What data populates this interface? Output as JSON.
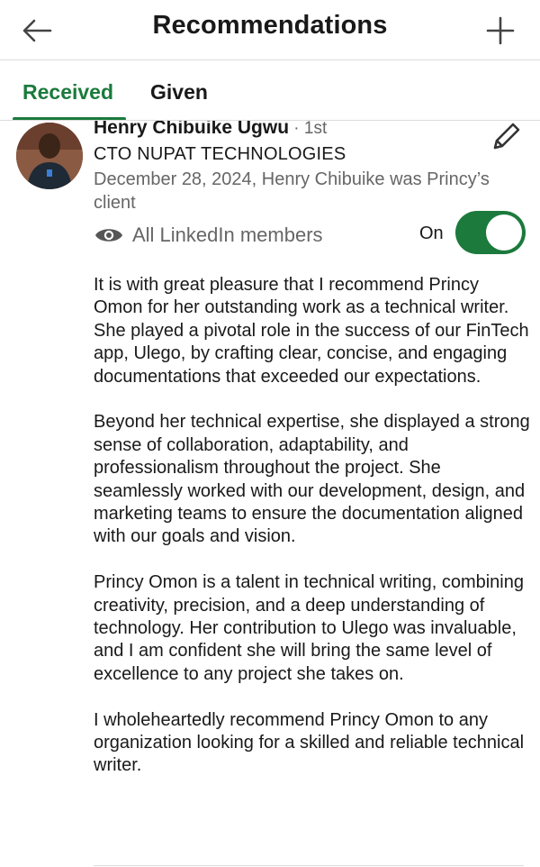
{
  "header": {
    "title": "Recommendations",
    "back_icon": "arrow-left-icon",
    "add_icon": "plus-icon"
  },
  "tabs": [
    {
      "label": "Received",
      "active": true
    },
    {
      "label": "Given",
      "active": false
    }
  ],
  "colors": {
    "accent": "#1b7a3c",
    "text_primary": "#191919",
    "text_secondary": "#666666",
    "divider": "#dcdcdc"
  },
  "recommendation": {
    "name": "Henry Chibuike Ugwu",
    "degree": " · 1st",
    "headline": "CTO NUPAT TECHNOLOGIES",
    "meta": "December 28, 2024, Henry Chibuike was Princy’s client",
    "edit_icon": "pencil-icon",
    "visibility": {
      "icon": "eye-icon",
      "label": "All LinkedIn members",
      "toggle_label": "On",
      "toggle_on": true
    },
    "paragraphs": [
      "It is with great pleasure that I recommend Princy Omon for her outstanding work as a technical writer. She played a pivotal role in the success of our FinTech app, Ulego, by crafting clear, concise, and engaging documentations that exceeded our expectations.",
      "Beyond her technical expertise, she displayed a strong sense of collaboration, adaptability, and professionalism throughout the project. She seamlessly worked with our development, design, and marketing teams to ensure the documentation aligned with our goals and vision.",
      "Princy Omon is a talent in technical writing, combining creativity, precision, and a deep understanding of technology. Her contribution to Ulego was invaluable, and I am confident she will bring the same level of excellence to any project she takes on.",
      "I wholeheartedly recommend Princy Omon to any organization looking for a skilled and reliable technical writer."
    ]
  }
}
